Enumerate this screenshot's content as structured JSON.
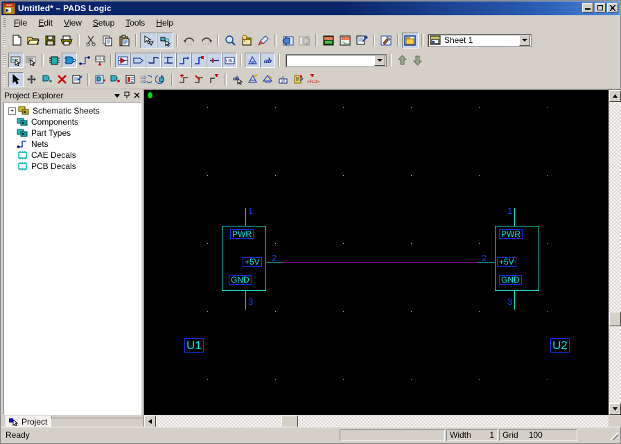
{
  "window": {
    "title": "Untitled* – PADS Logic",
    "icon": "pads-app-icon",
    "buttons": {
      "minimize": "–",
      "maximize": "□",
      "close": "✕"
    }
  },
  "menu": [
    {
      "label": "File",
      "accel": "F"
    },
    {
      "label": "Edit",
      "accel": "E"
    },
    {
      "label": "View",
      "accel": "V"
    },
    {
      "label": "Setup",
      "accel": "S"
    },
    {
      "label": "Tools",
      "accel": "T"
    },
    {
      "label": "Help",
      "accel": "H"
    }
  ],
  "toolbar_standard": {
    "sheet_combo": {
      "value": "Sheet 1",
      "icon": "sheet-icon"
    },
    "buttons": [
      {
        "name": "new-file",
        "icon": "new-document-icon",
        "pressed": false
      },
      {
        "name": "open-file",
        "icon": "open-folder-icon",
        "pressed": false
      },
      {
        "name": "save-file",
        "icon": "floppy-disk-icon",
        "pressed": false
      },
      {
        "name": "print",
        "icon": "printer-icon",
        "pressed": false
      },
      {
        "name": "cut",
        "icon": "scissors-icon",
        "pressed": false
      },
      {
        "name": "copy",
        "icon": "copy-pages-icon",
        "pressed": false
      },
      {
        "name": "paste",
        "icon": "clipboard-icon",
        "pressed": false
      },
      {
        "name": "select-tool",
        "icon": "arrow-filter-icon",
        "pressed": true
      },
      {
        "name": "net-select-tool",
        "icon": "net-select-icon",
        "pressed": true
      },
      {
        "name": "undo",
        "icon": "undo-arrow-icon",
        "pressed": false
      },
      {
        "name": "redo",
        "icon": "redo-arrow-icon",
        "pressed": false
      },
      {
        "name": "zoom",
        "icon": "magnifier-icon",
        "pressed": false
      },
      {
        "name": "query-modify",
        "icon": "query-window-icon",
        "pressed": false
      },
      {
        "name": "redraw",
        "icon": "paint-brush-icon",
        "pressed": false
      },
      {
        "name": "previous-sheet",
        "icon": "blue-left-arrow-icon",
        "pressed": false
      },
      {
        "name": "next-sheet",
        "icon": "gray-right-arrow-icon",
        "pressed": false
      },
      {
        "name": "pads-layout",
        "icon": "pads-layout-icon",
        "pressed": false
      },
      {
        "name": "pads-router",
        "icon": "pads-router-icon",
        "pressed": false
      },
      {
        "name": "ecо-options",
        "icon": "document-stamp-icon",
        "pressed": false
      },
      {
        "name": "basic-scripting",
        "icon": "hammer-icon",
        "pressed": false
      },
      {
        "name": "project-explorer-toggle",
        "icon": "explorer-window-icon",
        "pressed": true
      }
    ]
  },
  "toolbar_design": {
    "attribute_combo": {
      "value": "",
      "placeholder": ""
    },
    "buttons": [
      {
        "name": "select-anything",
        "icon": "select-net-icon",
        "pressed": true
      },
      {
        "name": "select-components",
        "icon": "select-parts-icon",
        "pressed": false
      },
      {
        "name": "add-part",
        "icon": "green-chip-icon",
        "pressed": false
      },
      {
        "name": "add-connection",
        "icon": "gate-connect-icon",
        "pressed": true
      },
      {
        "name": "add-net",
        "icon": "net-corner-icon",
        "pressed": false
      },
      {
        "name": "add-ref-designator",
        "icon": "u11-pin-icon",
        "pressed": false
      },
      {
        "name": "create-decal",
        "icon": "decal-red-icon",
        "pressed": true
      },
      {
        "name": "create-terminal",
        "icon": "terminal-shape-icon",
        "pressed": true
      },
      {
        "name": "create-2d-line",
        "icon": "step-line-icon",
        "pressed": true
      },
      {
        "name": "create-polygon",
        "icon": "closed-shape-icon",
        "pressed": true
      },
      {
        "name": "create-path",
        "icon": "path-curve-icon",
        "pressed": true
      },
      {
        "name": "create-corner",
        "icon": "red-corner-icon",
        "pressed": true
      },
      {
        "name": "add-pin",
        "icon": "red-cross-pin-icon",
        "pressed": true
      },
      {
        "name": "add-label",
        "icon": "lbl-icon",
        "pressed": true
      },
      {
        "name": "hatch-tool",
        "icon": "hatch-icon",
        "pressed": true
      },
      {
        "name": "text-tool",
        "icon": "ab-text-icon",
        "pressed": true
      },
      {
        "name": "move-up",
        "icon": "green-up-arrow-icon",
        "pressed": false
      },
      {
        "name": "move-down",
        "icon": "green-down-arrow-icon",
        "pressed": false
      }
    ]
  },
  "toolbar_edit": {
    "buttons": [
      {
        "name": "select-pointer",
        "icon": "pointer-arrow-icon",
        "pressed": true
      },
      {
        "name": "move-item",
        "icon": "four-way-move-icon",
        "pressed": false
      },
      {
        "name": "copy-item",
        "icon": "copy-gate-icon",
        "pressed": false
      },
      {
        "name": "delete-item",
        "icon": "red-x-delete-icon",
        "pressed": false
      },
      {
        "name": "properties",
        "icon": "properties-stamp-icon",
        "pressed": false
      },
      {
        "name": "add-gate",
        "icon": "add-gate-icon",
        "pressed": false
      },
      {
        "name": "add-part-green",
        "icon": "add-part-green-icon",
        "pressed": false
      },
      {
        "name": "swap-gate",
        "icon": "swap-gate-icon",
        "pressed": false
      },
      {
        "name": "swap-refdes",
        "icon": "u1-u2-swap-icon",
        "pressed": false
      },
      {
        "name": "rotate-gate",
        "icon": "rotate-gate-icon",
        "pressed": false
      },
      {
        "name": "add-net-red",
        "icon": "add-net-red-icon",
        "pressed": false
      },
      {
        "name": "delete-net",
        "icon": "delete-net-icon",
        "pressed": false
      },
      {
        "name": "add-bus",
        "icon": "add-bus-red-icon",
        "pressed": false
      },
      {
        "name": "edit-text",
        "icon": "ab-pointer-icon",
        "pressed": false
      },
      {
        "name": "edit-attributes",
        "icon": "edit-attr-icon",
        "pressed": false
      },
      {
        "name": "attribute-visibility",
        "icon": "attr-visibility-icon",
        "pressed": false
      },
      {
        "name": "add-text-field",
        "icon": "ab-box-icon",
        "pressed": false
      },
      {
        "name": "field-properties",
        "icon": "field-props-icon",
        "pressed": false
      },
      {
        "name": "add-field",
        "icon": "plus-fld-icon",
        "pressed": false
      }
    ]
  },
  "explorer": {
    "title": "Project Explorer",
    "header_buttons": [
      {
        "name": "dropdown-menu",
        "glyph": "▼"
      },
      {
        "name": "auto-hide-pin",
        "glyph": "⊞"
      },
      {
        "name": "close-panel",
        "glyph": "✕"
      }
    ],
    "tree": [
      {
        "label": "Schematic Sheets",
        "icon": "schematic-sheets-icon",
        "expandable": true,
        "expander": "+"
      },
      {
        "label": "Components",
        "icon": "components-icon",
        "expandable": false
      },
      {
        "label": "Part Types",
        "icon": "part-types-icon",
        "expandable": false
      },
      {
        "label": "Nets",
        "icon": "nets-icon",
        "expandable": false
      },
      {
        "label": "CAE Decals",
        "icon": "cae-decals-icon",
        "expandable": false
      },
      {
        "label": "PCB Decals",
        "icon": "pcb-decals-icon",
        "expandable": false
      }
    ],
    "tab": {
      "label": "Project",
      "icon": "project-tab-icon"
    }
  },
  "canvas": {
    "background_color": "#000000",
    "origin_marker_color": "#00dd00",
    "grid_dot_color": "#b0b0b0",
    "grid_spacing_px": 98,
    "wire_color": "#cc00cc",
    "symbol_color": "#17e0c8",
    "pin_number_color": "#1040ff",
    "components": [
      {
        "ref": "U1",
        "ref_side": "left",
        "pins": [
          {
            "number": "1",
            "label": "PWR",
            "side": "top"
          },
          {
            "number": "2",
            "label": "+5V",
            "side": "right"
          },
          {
            "number": "3",
            "label": "GND",
            "side": "bottom"
          }
        ]
      },
      {
        "ref": "U2",
        "ref_side": "right",
        "pins": [
          {
            "number": "1",
            "label": "PWR",
            "side": "top"
          },
          {
            "number": "2",
            "label": "+5V",
            "side": "left"
          },
          {
            "number": "3",
            "label": "GND",
            "side": "bottom"
          }
        ]
      }
    ],
    "nets": [
      {
        "from": "U1.2",
        "to": "U2.2",
        "color": "#cc00cc"
      }
    ]
  },
  "scrollbars": {
    "vertical": {
      "up_glyph": "▲",
      "down_glyph": "▼"
    },
    "horizontal": {
      "left_glyph": "◄",
      "right_glyph": "►"
    }
  },
  "statusbar": {
    "message": "Ready",
    "width_label": "Width",
    "width_value": "1",
    "grid_label": "Grid",
    "grid_value": "100"
  }
}
